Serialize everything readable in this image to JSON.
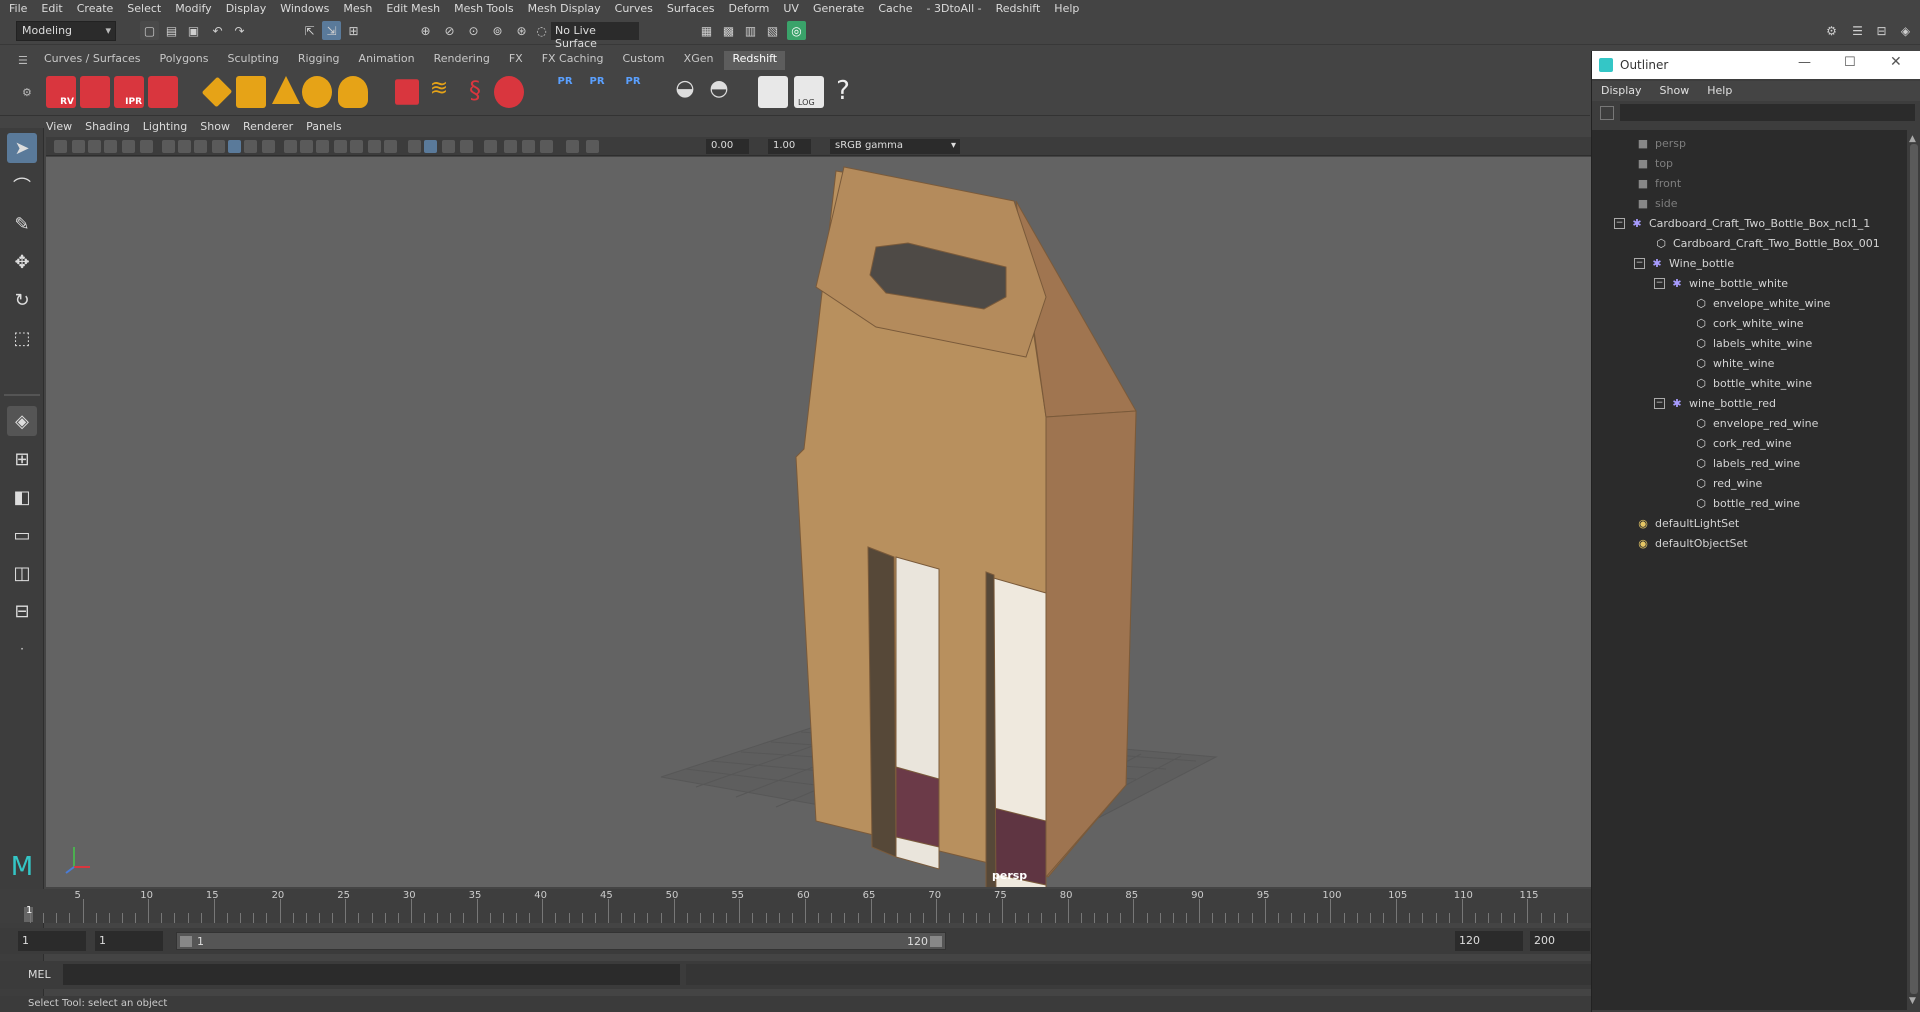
{
  "menubar": [
    "File",
    "Edit",
    "Create",
    "Select",
    "Modify",
    "Display",
    "Windows",
    "Mesh",
    "Edit Mesh",
    "Mesh Tools",
    "Mesh Display",
    "Curves",
    "Surfaces",
    "Deform",
    "UV",
    "Generate",
    "Cache",
    "- 3DtoAll -",
    "Redshift",
    "Help"
  ],
  "status": {
    "mode": "Modeling",
    "live_surface": "No Live Surface"
  },
  "shelf_tabs": [
    "Curves / Surfaces",
    "Polygons",
    "Sculpting",
    "Rigging",
    "Animation",
    "Rendering",
    "FX",
    "FX Caching",
    "Custom",
    "XGen",
    "Redshift"
  ],
  "shelf_active": "Redshift",
  "shelf_labels": {
    "rv": "RV",
    "ipr": "IPR",
    "pr": "PR",
    "log": "LOG",
    "help": "?"
  },
  "panel_menu": [
    "View",
    "Shading",
    "Lighting",
    "Show",
    "Renderer",
    "Panels"
  ],
  "panel_toolbar": {
    "exposure": "0.00",
    "gamma": "1.00",
    "colorspace": "sRGB gamma"
  },
  "viewport": {
    "camera_label": "persp"
  },
  "timeline": {
    "ticks": [
      "5",
      "10",
      "15",
      "20",
      "25",
      "30",
      "35",
      "40",
      "45",
      "50",
      "55",
      "60",
      "65",
      "70",
      "75",
      "80",
      "85",
      "90",
      "95",
      "100",
      "105",
      "110",
      "115"
    ],
    "current": "1"
  },
  "range": {
    "start": "1",
    "start2": "1",
    "slider_start": "1",
    "slider_end": "120",
    "end": "120",
    "end2": "200"
  },
  "cmd": {
    "label": "MEL"
  },
  "helpline": "Select Tool: select an object",
  "outliner": {
    "title": "Outliner",
    "menu": [
      "Display",
      "Show",
      "Help"
    ],
    "rows": [
      {
        "label": "persp",
        "type": "cam",
        "indent": 0
      },
      {
        "label": "top",
        "type": "cam",
        "indent": 0
      },
      {
        "label": "front",
        "type": "cam",
        "indent": 0
      },
      {
        "label": "side",
        "type": "cam",
        "indent": 0
      },
      {
        "label": "Cardboard_Craft_Two_Bottle_Box_ncl1_1",
        "type": "group",
        "indent": 0,
        "exp": "−"
      },
      {
        "label": "Cardboard_Craft_Two_Bottle_Box_001",
        "type": "mesh",
        "indent": 1
      },
      {
        "label": "Wine_bottle",
        "type": "group",
        "indent": 1,
        "exp": "−"
      },
      {
        "label": "wine_bottle_white",
        "type": "group",
        "indent": 2,
        "exp": "−"
      },
      {
        "label": "envelope_white_wine",
        "type": "mesh",
        "indent": 3
      },
      {
        "label": "cork_white_wine",
        "type": "mesh",
        "indent": 3
      },
      {
        "label": "labels_white_wine",
        "type": "mesh",
        "indent": 3
      },
      {
        "label": "white_wine",
        "type": "mesh",
        "indent": 3
      },
      {
        "label": "bottle_white_wine",
        "type": "mesh",
        "indent": 3
      },
      {
        "label": "wine_bottle_red",
        "type": "group",
        "indent": 2,
        "exp": "−"
      },
      {
        "label": "envelope_red_wine",
        "type": "mesh",
        "indent": 3
      },
      {
        "label": "cork_red_wine",
        "type": "mesh",
        "indent": 3
      },
      {
        "label": "labels_red_wine",
        "type": "mesh",
        "indent": 3
      },
      {
        "label": "red_wine",
        "type": "mesh",
        "indent": 3
      },
      {
        "label": "bottle_red_wine",
        "type": "mesh",
        "indent": 3
      },
      {
        "label": "defaultLightSet",
        "type": "set",
        "indent": 0
      },
      {
        "label": "defaultObjectSet",
        "type": "set",
        "indent": 0
      }
    ]
  }
}
